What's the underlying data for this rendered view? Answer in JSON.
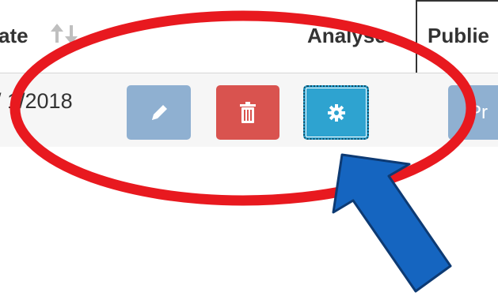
{
  "table": {
    "headers": {
      "date": "ate",
      "analyse": "Analyse",
      "publish": "Publie"
    },
    "row": {
      "date": "/ 1/2018",
      "publish_button": "Pr"
    }
  },
  "icons": {
    "sort": "sort-icon",
    "edit": "pencil-icon",
    "delete": "trash-icon",
    "analyse": "gear-icon"
  },
  "colors": {
    "edit_button": "#8fb0d1",
    "delete_button": "#d9534f",
    "analyse_button": "#2ea3d0",
    "highlight_ellipse": "#e8191f",
    "pointer_arrow": "#1565c0"
  }
}
